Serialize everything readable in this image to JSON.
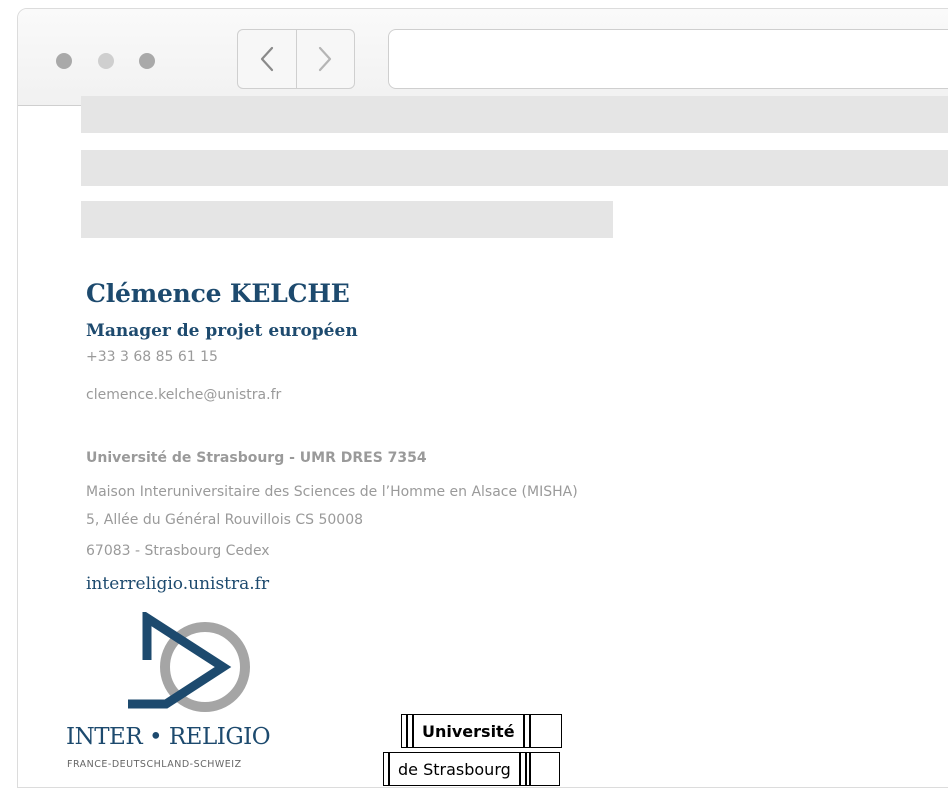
{
  "browser": {
    "back_icon": "chevron-left-icon",
    "forward_icon": "chevron-right-icon",
    "window_dots": [
      "close-dot",
      "minimize-dot",
      "maximize-dot"
    ]
  },
  "signature": {
    "name": "Clémence KELCHE",
    "role": "Manager de projet européen",
    "phone": "+33 3 68 85 61 15",
    "email": "clemence.kelche@unistra.fr",
    "organization": "Université de Strasbourg - UMR DRES 7354",
    "address_line1": "Maison Interuniversitaire des Sciences de l’Homme en Alsace (MISHA)",
    "address_line2": "5, Allée du Général Rouvillois CS 50008",
    "address_line3": "67083 - Strasbourg Cedex",
    "website": "interreligio.unistra.fr"
  },
  "logos": {
    "inter_religio": {
      "title": "INTER • RELIGIO",
      "subtitle": "FRANCE-DEUTSCHLAND-SCHWEIZ"
    },
    "unistra": {
      "line1": "Université",
      "line2": "de Strasbourg"
    }
  },
  "colors": {
    "brand_blue": "#1d4a6e",
    "text_grey": "#9a9a9a",
    "placeholder_grey": "#e5e5e5",
    "logo_grey": "#a5a5a5"
  }
}
